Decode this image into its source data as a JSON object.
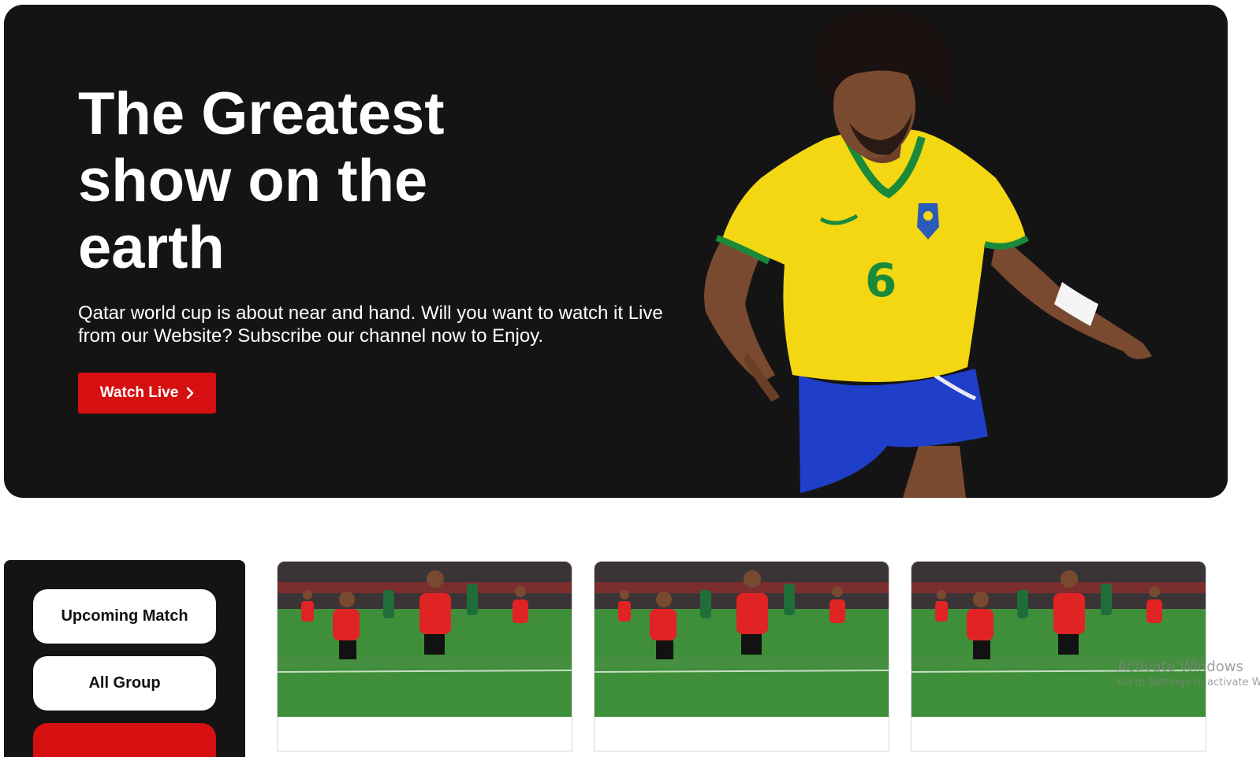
{
  "hero": {
    "title": "The Greatest show on the earth",
    "description": "Qatar world cup is about near and hand. Will you want to watch it Live from our Website? Subscribe our channel now to Enjoy.",
    "cta_label": "Watch Live",
    "colors": {
      "background": "#151415",
      "accent": "#d60f10",
      "text": "#ffffff"
    }
  },
  "sidebar": {
    "items": [
      {
        "label": "Upcoming Match"
      },
      {
        "label": "All Group"
      },
      {
        "label": ""
      }
    ]
  },
  "match_cards": [
    {
      "image": "players-celebrating-photo"
    },
    {
      "image": "players-celebrating-photo"
    },
    {
      "image": "players-celebrating-photo"
    }
  ],
  "os_watermark": {
    "line1": "Activate Windows",
    "line2": "Go to Settings to activate Windows."
  }
}
